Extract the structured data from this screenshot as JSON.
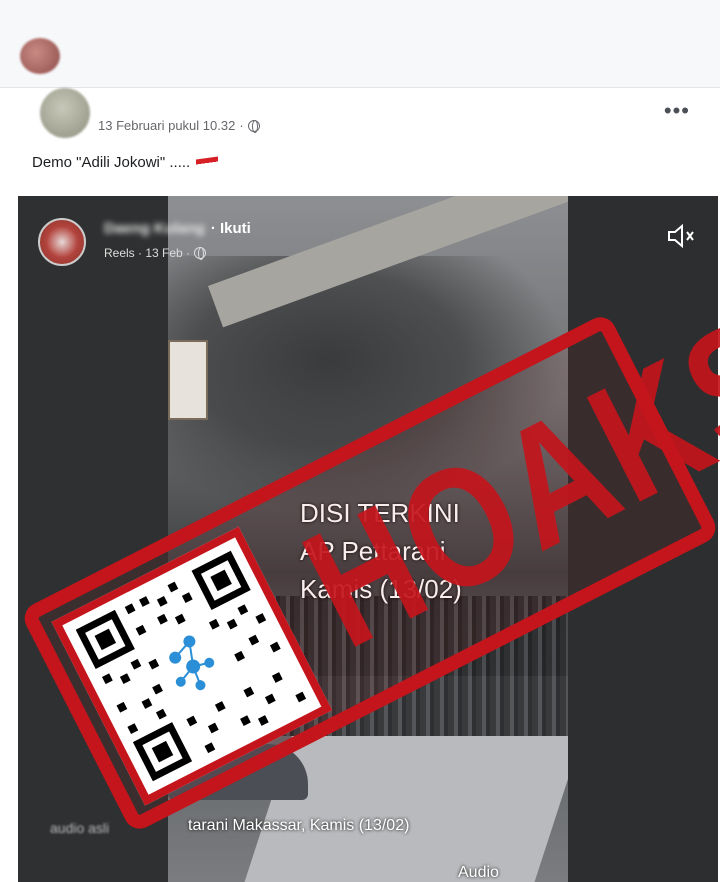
{
  "post": {
    "timestamp": "13 Februari pukul 10.32",
    "more_label": "•••",
    "caption_text": "Demo \"Adili Jokowi\" ....."
  },
  "embed": {
    "author_blurred": "Daeng Kulang",
    "follow_label": "· Ikuti",
    "meta": "Reels · 13 Feb ·"
  },
  "video": {
    "headline": [
      "DISI TERKINI",
      "AP Pettarani",
      "Kamis (13/02)"
    ],
    "caption": "tarani Makassar, Kamis (13/02)",
    "caption_left": "audio asli",
    "audio_label": "Audio"
  },
  "stamp": {
    "text": "HOAKS",
    "color": "#c4151c"
  },
  "colors": {
    "flag_red": "#d71f26",
    "flag_white": "#ffffff"
  }
}
